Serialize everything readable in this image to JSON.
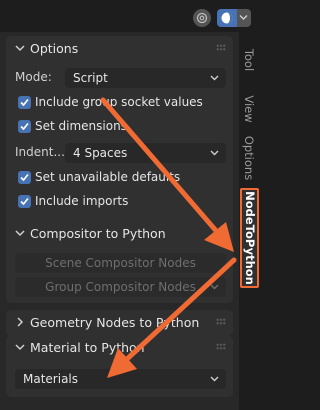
{
  "header": {
    "overlay_icon": "overlay-icon",
    "shading_icon": "viewport-shading-icon"
  },
  "panels": {
    "options": {
      "title": "Options",
      "mode_label": "Mode:",
      "mode_value": "Script",
      "include_group_socket_values": "Include group socket values",
      "set_dimensions": "Set dimensions",
      "indentation_label": "Indent...",
      "indentation_value": "4 Spaces",
      "set_unavailable_defaults": "Set unavailable defaults",
      "include_imports": "Include imports"
    },
    "compositor": {
      "title": "Compositor to Python",
      "scene_button": "Scene Compositor Nodes",
      "group_button": "Group Compositor Nodes"
    },
    "geometry": {
      "title": "Geometry Nodes to Python"
    },
    "material": {
      "title": "Material to Python",
      "materials_button": "Materials"
    }
  },
  "tabs": [
    "Tool",
    "View",
    "Options",
    "NodeToPython"
  ],
  "active_tab": "NodeToPython",
  "colors": {
    "accent_blue": "#4772b3",
    "annotation_orange": "#f06a34",
    "panel_bg": "#303030",
    "sidebar_bg": "#282828"
  }
}
